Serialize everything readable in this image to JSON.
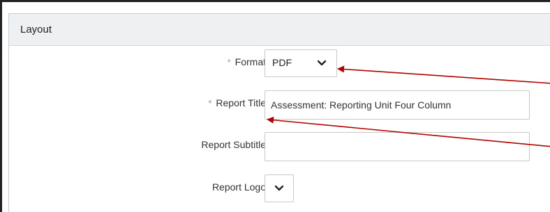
{
  "section": {
    "title": "Layout"
  },
  "form": {
    "format": {
      "label": "Format",
      "required_marker": "*",
      "value": "PDF"
    },
    "report_title": {
      "label": "Report Title",
      "required_marker": "*",
      "value": "Assessment: Reporting Unit Four Column"
    },
    "report_subtitle": {
      "label": "Report Subtitle",
      "value": ""
    },
    "report_logo": {
      "label": "Report Logo",
      "value": ""
    }
  },
  "colors": {
    "annotation_arrow": "#b00000",
    "header_background": "#eef0f2"
  }
}
